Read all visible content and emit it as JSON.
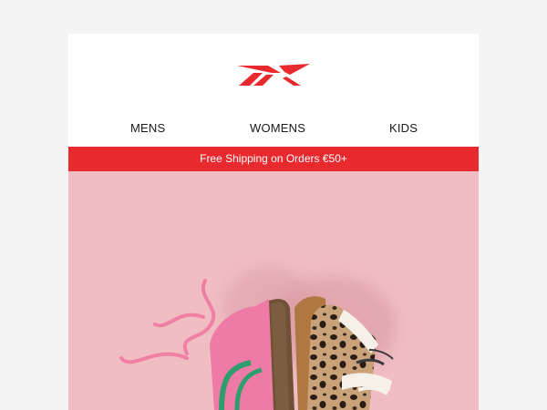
{
  "brand": {
    "logo_icon": "reebok-vector-logo",
    "accent_color": "#e8292d"
  },
  "nav": {
    "items": [
      {
        "label": "MENS"
      },
      {
        "label": "WOMENS"
      },
      {
        "label": "KIDS"
      }
    ]
  },
  "promo_banner": {
    "text": "Free Shipping on Orders €50+",
    "background": "#e8292d"
  },
  "hero": {
    "background": "#f0bdc3",
    "image_icon": "sneakers-hero-image"
  }
}
